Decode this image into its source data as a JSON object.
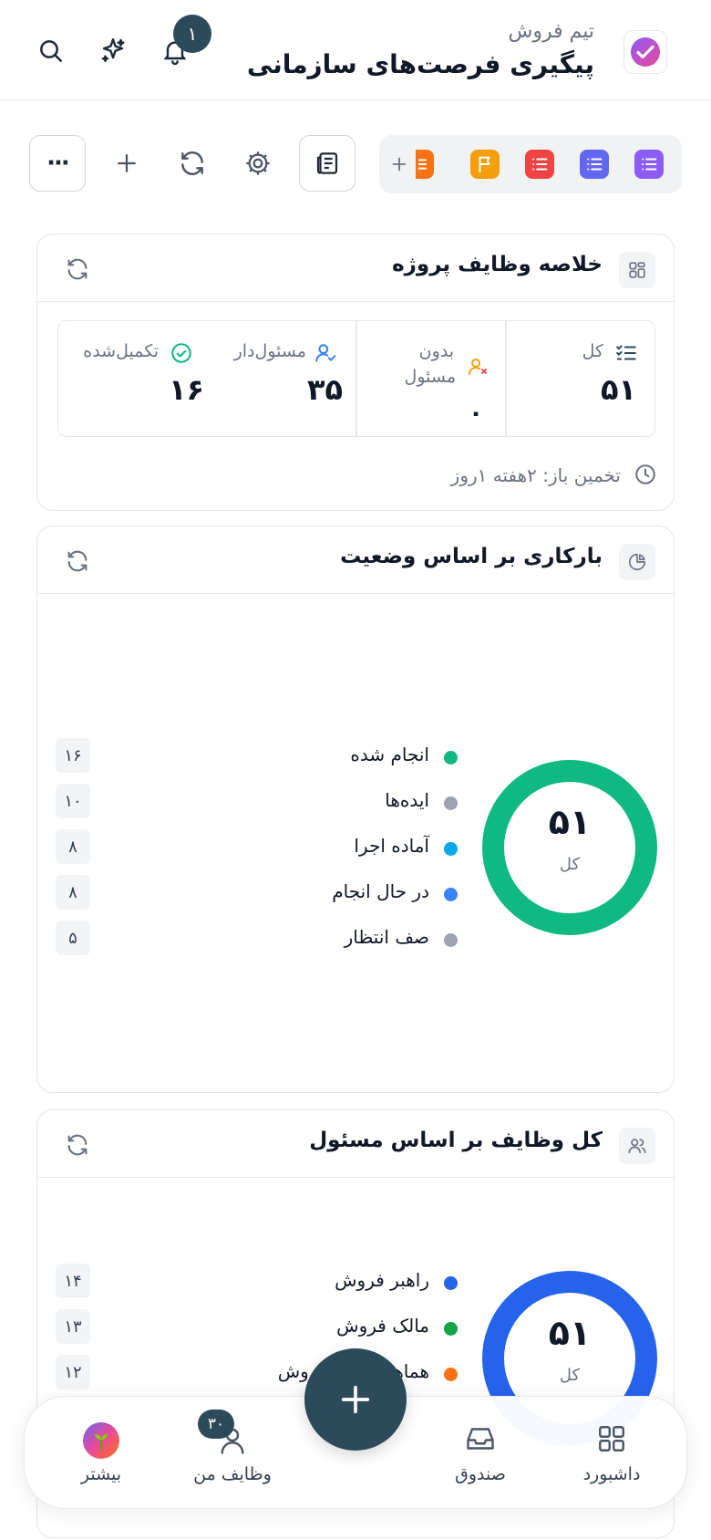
{
  "header": {
    "team_name": "تیم فروش",
    "page_title": "پیگیری فرصت‌های سازمانی",
    "notification_count": "۱"
  },
  "toolbar": {
    "more_label": "···",
    "list_tab_colors": [
      "#8b5cf6",
      "#6366f1",
      "#ef4444",
      "#f59e0b",
      "#f97316"
    ]
  },
  "summary": {
    "title": "خلاصه وظایف پروژه",
    "total_label": "کل",
    "total_value": "۵۱",
    "unassigned_label_line1": "بدون",
    "unassigned_label_line2": "مسئول",
    "unassigned_value": "۰",
    "assigned_label": "مسئول‌دار",
    "assigned_value": "۳۵",
    "completed_label": "تکمیل‌شده",
    "completed_value": "۱۶",
    "estimate": "تخمین باز: ۲هفته ۱روز"
  },
  "status_chart": {
    "title": "بارکاری بر اساس وضعیت",
    "total": "۵۱",
    "total_label": "کل",
    "items": [
      {
        "label": "انجام شده",
        "count": "۱۶",
        "color": "#10b981"
      },
      {
        "label": "ایده‌ها",
        "count": "۱۰",
        "color": "#9ca3af"
      },
      {
        "label": "آماده اجرا",
        "count": "۸",
        "color": "#0ea5e9"
      },
      {
        "label": "در حال انجام",
        "count": "۸",
        "color": "#3b82f6"
      },
      {
        "label": "صف انتظار",
        "count": "۵",
        "color": "#9ca3af"
      }
    ]
  },
  "assignee_chart": {
    "title": "کل وظایف بر اساس مسئول",
    "total": "۵۱",
    "total_label": "کل",
    "items": [
      {
        "label": "راهبر فروش",
        "count": "۱۴",
        "color": "#2563eb"
      },
      {
        "label": "مالک فروش",
        "count": "۱۳",
        "color": "#16a34a"
      },
      {
        "label": "هماهنگ‌کننده فروش",
        "count": "۱۲",
        "color": "#f97316"
      }
    ]
  },
  "bottom_nav": {
    "dashboard": "داشبورد",
    "inbox": "صندوق",
    "my_tasks": "وظایف من",
    "my_tasks_badge": "۳۰",
    "more": "بیشتر"
  }
}
